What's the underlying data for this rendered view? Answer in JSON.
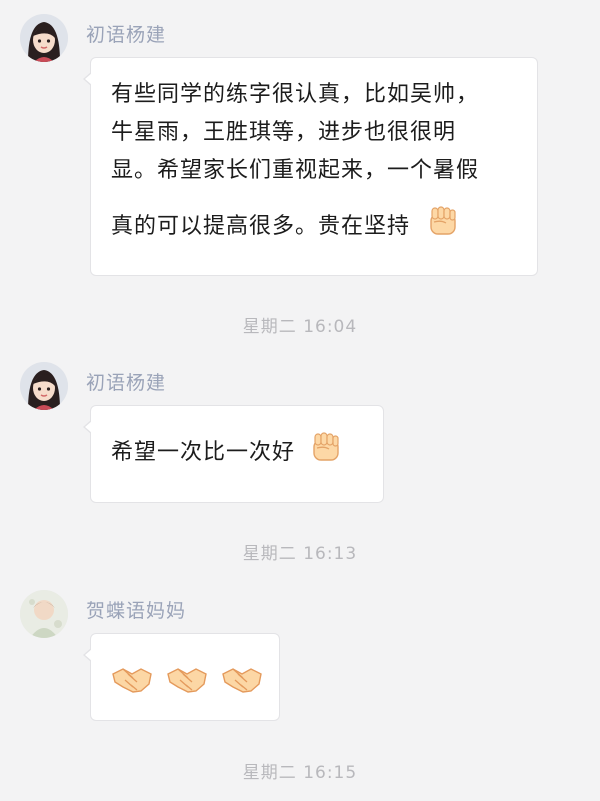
{
  "messages": [
    {
      "sender": "初语杨建",
      "lines": [
        "有些同学的练字很认真，比如吴帅，",
        "牛星雨，王胜琪等，进步也很很明",
        "显。希望家长们重视起来，一个暑假"
      ],
      "last_line": "真的可以提高很多。贵在坚持",
      "emoji": "raised-fist-icon"
    },
    {
      "sender": "初语杨建",
      "text": "希望一次比一次好",
      "emoji": "raised-fist-icon"
    },
    {
      "sender": "贺蝶语妈妈",
      "emojis": [
        "handshake-icon",
        "handshake-icon",
        "handshake-icon"
      ]
    }
  ],
  "timestamps": [
    "星期二 16:04",
    "星期二 16:13",
    "星期二 16:15"
  ],
  "colors": {
    "background": "#f3f3f4",
    "sender_name": "#9aa3b8",
    "timestamp": "#b8b8bc",
    "bubble": "#ffffff"
  }
}
